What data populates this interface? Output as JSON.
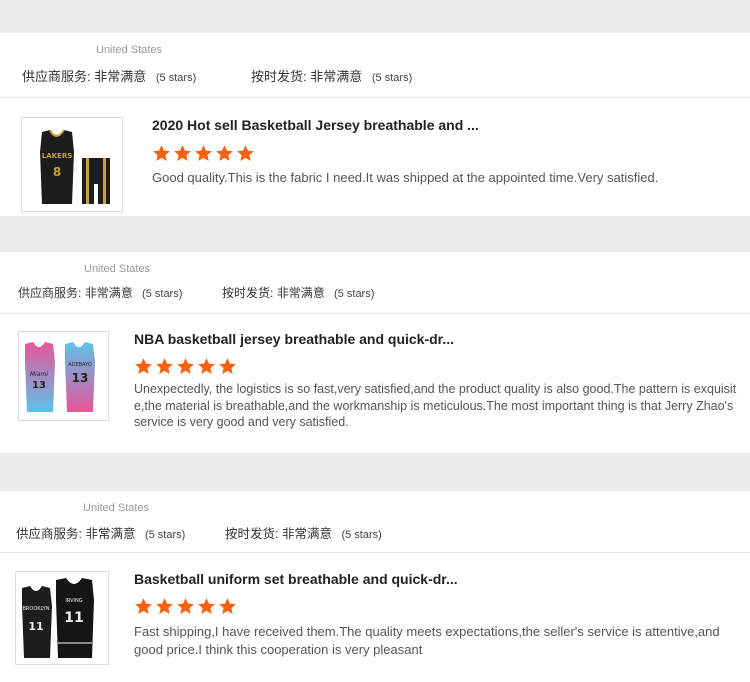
{
  "reviews": [
    {
      "country": "United States",
      "supplier_service_label": "供应商服务:",
      "supplier_service_value": "非常满意",
      "supplier_service_stars": "(5 stars)",
      "shipping_label": "按时发货:",
      "shipping_value": "非常满意",
      "shipping_stars": "(5 stars)",
      "product_title": "2020 Hot sell Basketball Jersey breathable and ...",
      "rating": 5,
      "text": "Good quality.This is the fabric I need.It was shipped at the appointed time.Very satisfied.",
      "image_icon": "lakers-black-jersey-icon"
    },
    {
      "country": "United States",
      "supplier_service_label": "供应商服务:",
      "supplier_service_value": "非常满意",
      "supplier_service_stars": "(5 stars)",
      "shipping_label": "按时发货:",
      "shipping_value": "非常满意",
      "shipping_stars": "(5 stars)",
      "product_title": "NBA basketball jersey breathable and quick-dr...",
      "rating": 5,
      "text": "Unexpectedly, the logistics is so fast,very satisfied,and the product quality is also good.The pattern is exquisite,the material is breathable,and the workmanship is meticulous.The most important thing is that Jerry Zhao's service is very good and very satisfied.",
      "image_icon": "miami-pink-blue-jersey-icon"
    },
    {
      "country": "United States",
      "supplier_service_label": "供应商服务:",
      "supplier_service_value": "非常满意",
      "supplier_service_stars": "(5 stars)",
      "shipping_label": "按时发货:",
      "shipping_value": "非常满意",
      "shipping_stars": "(5 stars)",
      "product_title": "Basketball uniform set breathable and quick-dr...",
      "rating": 5,
      "text": "Fast shipping,I have received them.The quality meets expectations,the seller's service is attentive,and good price.I think this cooperation is very pleasant",
      "image_icon": "brooklyn-black-jersey-icon"
    }
  ],
  "colors": {
    "star": "#f5620f",
    "background": "#ececec",
    "card": "#ffffff"
  }
}
